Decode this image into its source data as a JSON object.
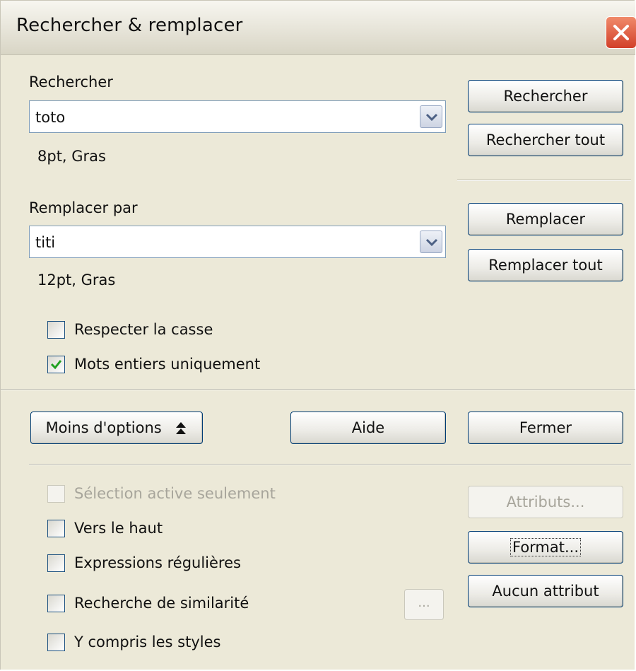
{
  "window": {
    "title": "Rechercher & remplacer"
  },
  "search": {
    "label": "Rechercher",
    "value": "toto",
    "format_info": "8pt, Gras"
  },
  "replace": {
    "label": "Remplacer par",
    "value": "titi",
    "format_info": "12pt, Gras"
  },
  "options": {
    "match_case": {
      "label": "Respecter la casse",
      "checked": false
    },
    "whole_words": {
      "label": "Mots entiers uniquement",
      "checked": true
    }
  },
  "buttons": {
    "search": "Rechercher",
    "search_all": "Rechercher tout",
    "replace": "Remplacer",
    "replace_all": "Remplacer tout",
    "fewer_options": "Moins d'options",
    "help": "Aide",
    "close": "Fermer",
    "attributes": "Attributs...",
    "format": "Format...",
    "no_attribute": "Aucun attribut",
    "similarity_settings": "..."
  },
  "extra_options": {
    "current_selection_only": {
      "label": "Sélection active seulement",
      "checked": false,
      "enabled": false
    },
    "backwards": {
      "label": "Vers le haut",
      "checked": false
    },
    "regular_expressions": {
      "label": "Expressions régulières",
      "checked": false
    },
    "similarity_search": {
      "label": "Recherche de similarité",
      "checked": false
    },
    "search_styles": {
      "label": "Y compris les styles",
      "checked": false
    }
  },
  "colors": {
    "dialog_bg": "#ece9d8",
    "button_border": "#003c74",
    "checkmark": "#21a121",
    "close_button": "#d2402a"
  },
  "icons": {
    "close": "close-icon",
    "dropdown": "chevron-down-icon",
    "collapse": "double-chevron-up-icon",
    "checkmark": "checkmark-icon"
  }
}
